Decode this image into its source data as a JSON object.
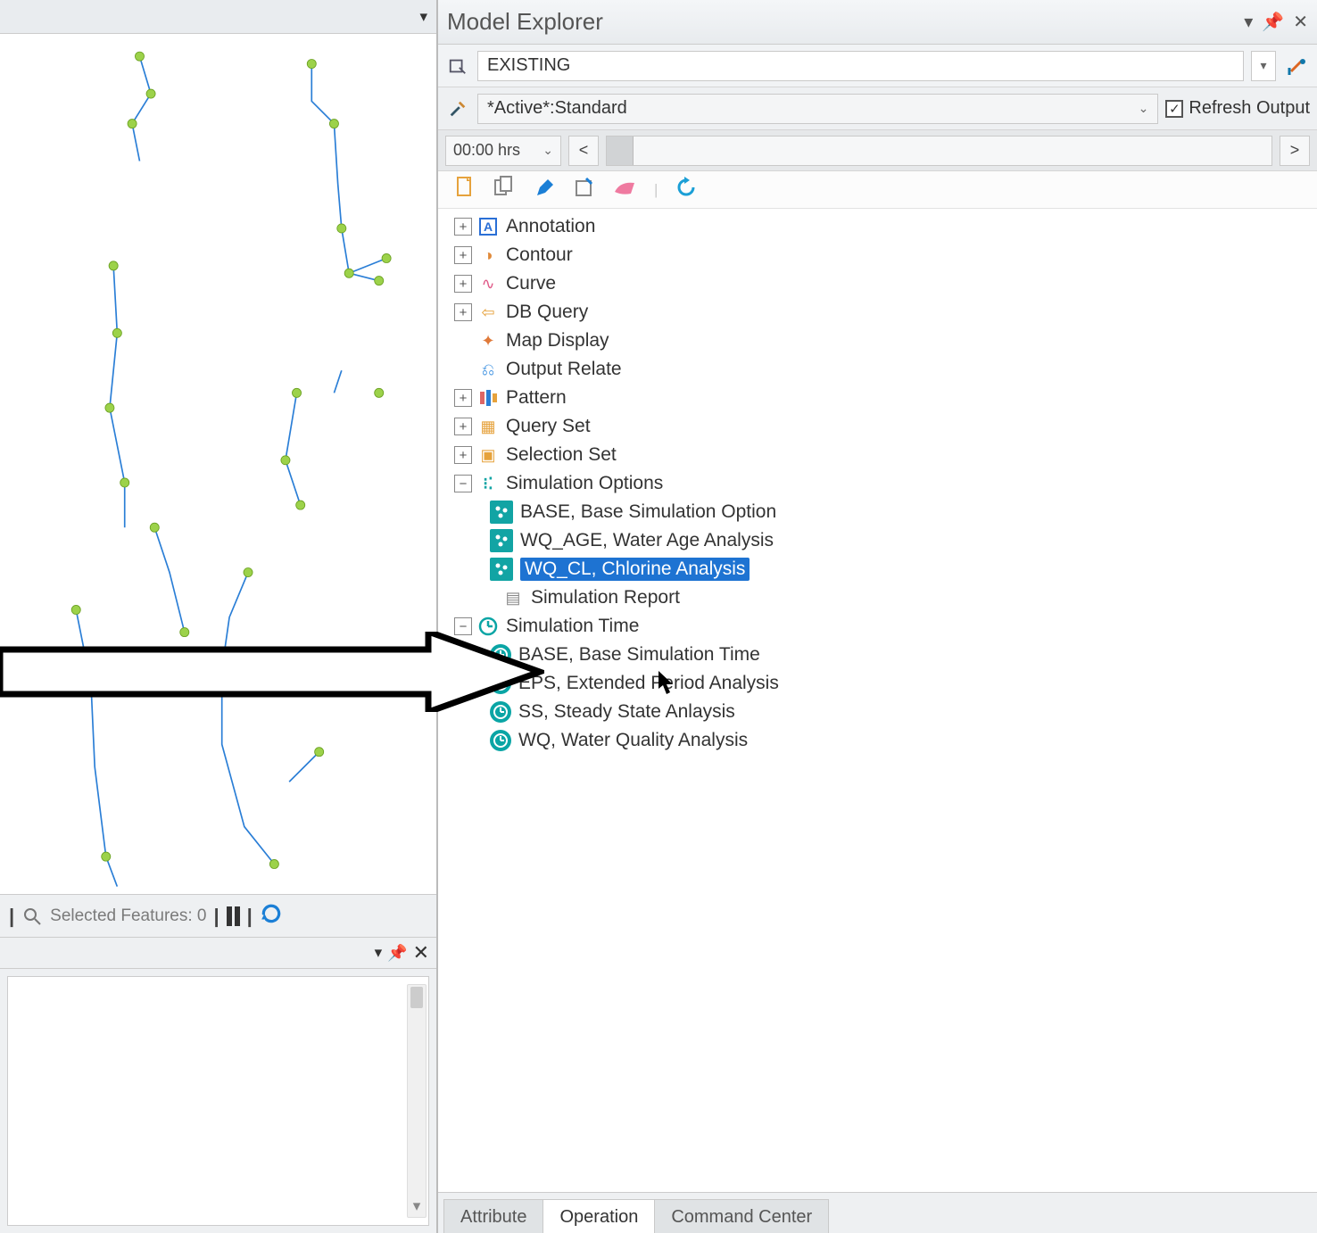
{
  "panel_title": "Model Explorer",
  "scenario_name": "EXISTING",
  "active_label": "*Active*:Standard",
  "refresh_label": "Refresh Output",
  "time_value": "00:00 hrs",
  "tree_toolbar_icons": [
    "new",
    "copy",
    "edit",
    "rename",
    "delete",
    "refresh"
  ],
  "tree": [
    {
      "label": "Annotation",
      "expandable": true,
      "expanded": false,
      "icon": "A",
      "iconColor": "#2a6fd6"
    },
    {
      "label": "Contour",
      "expandable": true,
      "expanded": false,
      "icon": "◑",
      "iconColor": "#e08a3a"
    },
    {
      "label": "Curve",
      "expandable": true,
      "expanded": false,
      "icon": "∿",
      "iconColor": "#e05a88"
    },
    {
      "label": "DB Query",
      "expandable": true,
      "expanded": false,
      "icon": "⇦",
      "iconColor": "#e6a23c"
    },
    {
      "label": "Map Display",
      "expandable": false,
      "icon": "✦",
      "iconColor": "#e07a3a"
    },
    {
      "label": "Output Relate",
      "expandable": false,
      "icon": "⎌",
      "iconColor": "#3a8fe0"
    },
    {
      "label": "Pattern",
      "expandable": true,
      "expanded": false,
      "icon": "▮▮▮",
      "iconColor": ""
    },
    {
      "label": "Query Set",
      "expandable": true,
      "expanded": false,
      "icon": "▦",
      "iconColor": "#e6a23c"
    },
    {
      "label": "Selection Set",
      "expandable": true,
      "expanded": false,
      "icon": "▣",
      "iconColor": "#e6a23c"
    },
    {
      "label": "Simulation Options",
      "expandable": true,
      "expanded": true,
      "icon": "••",
      "iconColor": "#12a4a4",
      "children": [
        {
          "label": "BASE, Base Simulation Option",
          "icon_type": "sim-opt"
        },
        {
          "label": "WQ_AGE, Water Age Analysis",
          "icon_type": "sim-opt"
        },
        {
          "label": "WQ_CL, Chlorine Analysis",
          "icon_type": "sim-opt",
          "selected": true
        }
      ]
    },
    {
      "label": "Simulation Report",
      "expandable": false,
      "level": "lvl2b",
      "icon": "▤",
      "iconColor": "#888"
    },
    {
      "label": "Simulation Time",
      "expandable": true,
      "expanded": true,
      "icon": "◷",
      "iconColor": "#0aa5a5",
      "children": [
        {
          "label": "BASE, Base Simulation Time",
          "icon_type": "sim-time"
        },
        {
          "label": "EPS, Extended Period Analysis",
          "icon_type": "sim-time"
        },
        {
          "label": "SS, Steady State Anlaysis",
          "icon_type": "sim-time"
        },
        {
          "label": "WQ, Water Quality Analysis",
          "icon_type": "sim-time"
        }
      ]
    }
  ],
  "selected_features": "Selected Features: 0",
  "tabs": [
    "Attribute",
    "Operation",
    "Command Center"
  ],
  "active_tab": "Operation"
}
